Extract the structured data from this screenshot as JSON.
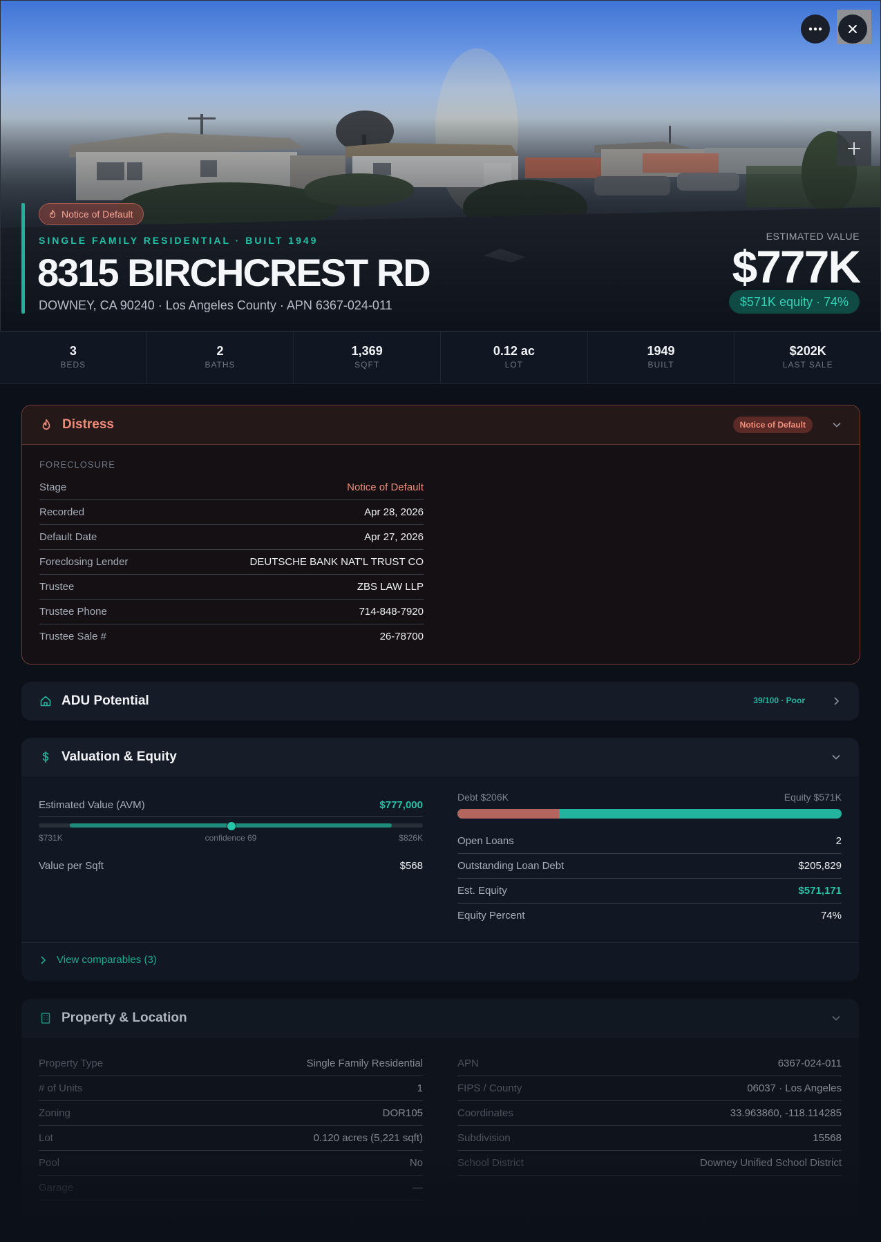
{
  "hero": {
    "status_badge": "Notice of Default",
    "eyebrow": "SINGLE FAMILY RESIDENTIAL · BUILT 1949",
    "address": "8315 BIRCHCREST RD",
    "subaddress": "DOWNEY, CA 90240 · Los Angeles County · APN 6367-024-011",
    "estimated_value_label": "ESTIMATED VALUE",
    "estimated_value": "$777K",
    "equity_pill": "$571K equity · 74%"
  },
  "stats": [
    {
      "value": "3",
      "label": "BEDS"
    },
    {
      "value": "2",
      "label": "BATHS"
    },
    {
      "value": "1,369",
      "label": "SQFT"
    },
    {
      "value": "0.12 ac",
      "label": "LOT"
    },
    {
      "value": "1949",
      "label": "BUILT"
    },
    {
      "value": "$202K",
      "label": "LAST SALE"
    }
  ],
  "distress": {
    "title": "Distress",
    "tag": "Notice of Default",
    "section_label": "FORECLOSURE",
    "rows": [
      {
        "k": "Stage",
        "v": "Notice of Default"
      },
      {
        "k": "Recorded",
        "v": "Apr 28, 2026"
      },
      {
        "k": "Default Date",
        "v": "Apr 27, 2026"
      },
      {
        "k": "Foreclosing Lender",
        "v": "DEUTSCHE BANK NAT'L TRUST CO"
      },
      {
        "k": "Trustee",
        "v": "ZBS LAW LLP"
      },
      {
        "k": "Trustee Phone",
        "v": "714-848-7920"
      },
      {
        "k": "Trustee Sale #",
        "v": "26-78700"
      }
    ]
  },
  "adu": {
    "title": "ADU Potential",
    "score": "39/100 · Poor"
  },
  "valuation": {
    "title": "Valuation & Equity",
    "avm_label": "Estimated Value (AVM)",
    "avm_value": "$777,000",
    "range_low": "$731K",
    "range_mid": "confidence 69",
    "range_high": "$826K",
    "vps_label": "Value per Sqft",
    "vps_value": "$568",
    "debt_label": "Debt $206K",
    "equity_label": "Equity $571K",
    "debt_fraction": 0.265,
    "rows": [
      {
        "k": "Open Loans",
        "v": "2"
      },
      {
        "k": "Outstanding Loan Debt",
        "v": "$205,829"
      },
      {
        "k": "Est. Equity",
        "v": "$571,171"
      },
      {
        "k": "Equity Percent",
        "v": "74%"
      }
    ],
    "comparables_link": "View comparables (3)"
  },
  "property": {
    "title": "Property & Location",
    "left_rows": [
      {
        "k": "Property Type",
        "v": "Single Family Residential"
      },
      {
        "k": "# of Units",
        "v": "1"
      },
      {
        "k": "Zoning",
        "v": "DOR105"
      },
      {
        "k": "Lot",
        "v": "0.120 acres (5,221 sqft)"
      },
      {
        "k": "Pool",
        "v": "No"
      },
      {
        "k": "Garage",
        "v": "—"
      }
    ],
    "right_rows": [
      {
        "k": "APN",
        "v": "6367-024-011"
      },
      {
        "k": "FIPS / County",
        "v": "06037 · Los Angeles"
      },
      {
        "k": "Coordinates",
        "v": "33.963860, -118.114285"
      },
      {
        "k": "Subdivision",
        "v": "15568"
      },
      {
        "k": "School District",
        "v": "Downey Unified School District"
      }
    ]
  },
  "colors": {
    "accent_teal": "#20b29c",
    "distress_red": "#f08a78",
    "background": "#0c1119"
  },
  "icons": {
    "more": "more-horizontal-icon",
    "close": "close-icon",
    "plus": "plus-icon",
    "flame": "flame-icon",
    "home": "home-icon",
    "dollar": "dollar-icon",
    "building": "building-icon",
    "chevron": "chevron-down-icon"
  }
}
